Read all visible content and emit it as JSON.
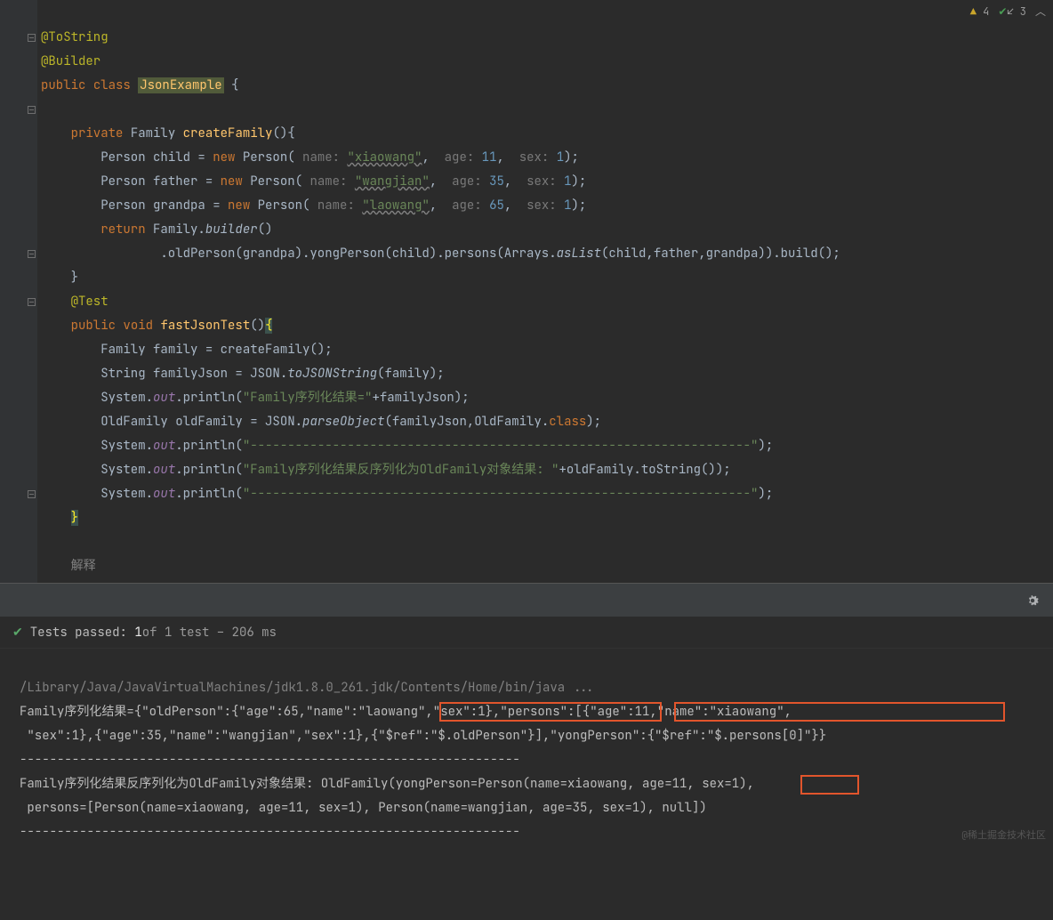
{
  "indicators": {
    "warn_count": "4",
    "check_count": "3"
  },
  "code": {
    "ann_tostring": "@ToString",
    "ann_builder": "@Builder",
    "kw_public": "public",
    "kw_class": "class",
    "cls_jsonexample": "JsonExample",
    "brace_open": " {",
    "kw_private": "private",
    "ty_family": "Family",
    "mth_createfamily": "createFamily",
    "paren_brace": "(){",
    "ty_person": "Person",
    "var_child": "child",
    "op_eq": " = ",
    "kw_new": "new",
    "hint_name": "name:",
    "str_xiaowang": "\"xiaowang\"",
    "hint_age": "age:",
    "n11": "11",
    "hint_sex": "sex:",
    "n1": "1",
    "close_sc": ");",
    "var_father": "father",
    "str_wangjian": "\"wangjian\"",
    "n35": "35",
    "var_grandpa": "grandpa",
    "str_laowang": "\"laowang\"",
    "n65": "65",
    "kw_return": "return",
    "mth_builder": "builder",
    "chain": ".oldPerson(grandpa).yongPerson(child).persons(Arrays.",
    "mth_aslist": "asList",
    "chain2": "(child,father,grandpa)).build();",
    "brace_close": "}",
    "ann_test": "@Test",
    "kw_void": "void",
    "mth_fastjson": "fastJsonTest",
    "paren": "()",
    "var_family": "family",
    "call_createfamily": "createFamily();",
    "ty_string": "String",
    "var_familyjson": "familyJson",
    "cls_json": "JSON",
    "mth_tojsonstring": "toJSONString",
    "arg_family": "(family);",
    "sys": "System.",
    "out": "out",
    "println": ".println(",
    "str_ser": "\"Family序列化结果=\"",
    "plus_fj": "+familyJson);",
    "ty_oldfamily": "OldFamily",
    "var_oldfamily": "oldFamily",
    "mth_parseobject": "parseObject",
    "arg_parse": "(familyJson,OldFamily.",
    "kw_class_lit": "class",
    "close_sc2": ");",
    "str_dash": "\"-------------------------------------------------------------------\"",
    "close_sc3": ");",
    "str_deser": "\"Family序列化结果反序列化为OldFamily对象结果: \"",
    "plus_old": "+oldFamily.toString());",
    "cmt_explain": "解释"
  },
  "tests": {
    "label": "Tests passed:",
    "passed": "1",
    "of_text": " of 1 test – 206 ms"
  },
  "console": {
    "path": "/Library/Java/JavaVirtualMachines/jdk1.8.0_261.jdk/Contents/Home/bin/java ...",
    "l1": "Family序列化结果={\"oldPerson\":{\"age\":65,\"name\":\"laowang\",\"sex\":1},\"persons\":[{\"age\":11,\"name\":\"xiaowang\",",
    "l2a": " \"sex\":1},{\"age\":35,\"name\":\"wangjian\",\"sex\":1}",
    "l2b": ",{\"$ref\":\"$.oldPerson\"}]",
    "l2c": ",",
    "l2d": "\"yongPerson\":{\"$ref\":\"$.persons[0]\"}}",
    "dashes": "-------------------------------------------------------------------",
    "l4": "Family序列化结果反序列化为OldFamily对象结果: OldFamily(yongPerson=Person(name=xiaowang, age=11, sex=1),",
    "l5a": " persons=[Person(name=xiaowang, age=11, sex=1), Person(name=wangjian, age=35, sex=1),",
    "l5b": " null]",
    "l5c": ")"
  },
  "watermark": "@稀土掘金技术社区"
}
